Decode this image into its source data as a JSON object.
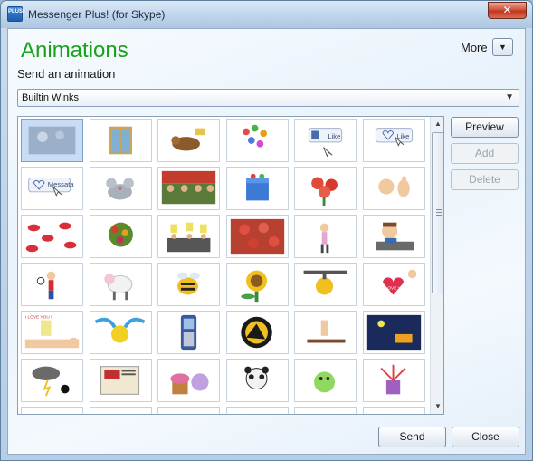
{
  "window": {
    "title": "Messenger Plus! (for Skype)",
    "icon_text": "PLUS!",
    "close_glyph": "✕"
  },
  "header": {
    "heading": "Animations",
    "more_label": "More",
    "more_arrow": "▼",
    "subtitle": "Send an animation"
  },
  "dropdown": {
    "selected": "Builtin Winks",
    "arrow": "▼"
  },
  "grid": {
    "selected_index": 0,
    "items": [
      {
        "name": "wink-fireworks-icon"
      },
      {
        "name": "wink-doors-icon"
      },
      {
        "name": "wink-sleeping-cat-icon"
      },
      {
        "name": "wink-balloons-icon"
      },
      {
        "name": "wink-like-button-icon",
        "text": "Like"
      },
      {
        "name": "wink-like-cursor-icon",
        "text": "Like"
      },
      {
        "name": "wink-messata-button-icon",
        "text": "Messata"
      },
      {
        "name": "wink-mouse-icon"
      },
      {
        "name": "wink-crowd-icon"
      },
      {
        "name": "wink-gift-box-icon"
      },
      {
        "name": "wink-roses-icon"
      },
      {
        "name": "wink-thumbs-up-icon"
      },
      {
        "name": "wink-kisses-icon"
      },
      {
        "name": "wink-flower-bouquet-icon"
      },
      {
        "name": "wink-score-cards-icon"
      },
      {
        "name": "wink-rose-bed-icon"
      },
      {
        "name": "wink-dancer-icon"
      },
      {
        "name": "wink-man-at-desk-icon"
      },
      {
        "name": "wink-tennis-player-icon"
      },
      {
        "name": "wink-sheep-icon"
      },
      {
        "name": "wink-bee-icon"
      },
      {
        "name": "wink-sunflower-icon"
      },
      {
        "name": "wink-bomb-icon"
      },
      {
        "name": "wink-love-heart-icon",
        "text": "I LOVE YOU"
      },
      {
        "name": "wink-hand-note-icon",
        "text": "I LOVE YOU !"
      },
      {
        "name": "wink-crying-face-icon"
      },
      {
        "name": "wink-mobile-phone-icon"
      },
      {
        "name": "wink-witch-moon-icon"
      },
      {
        "name": "wink-hand-wave-icon"
      },
      {
        "name": "wink-night-scene-icon"
      },
      {
        "name": "wink-storm-cloud-icon"
      },
      {
        "name": "wink-newspaper-icon"
      },
      {
        "name": "wink-cupcake-icon"
      },
      {
        "name": "wink-panda-icon"
      },
      {
        "name": "wink-green-blob-icon"
      },
      {
        "name": "wink-gift-explosion-icon"
      },
      {
        "name": "wink-partial-1-icon"
      },
      {
        "name": "wink-partial-2-icon"
      },
      {
        "name": "wink-partial-3-icon"
      },
      {
        "name": "wink-partial-4-icon"
      },
      {
        "name": "wink-partial-5-icon"
      },
      {
        "name": "wink-partial-6-icon"
      }
    ]
  },
  "scrollbar": {
    "up": "▲",
    "down": "▼"
  },
  "side_buttons": {
    "preview": "Preview",
    "add": "Add",
    "delete": "Delete"
  },
  "footer": {
    "send": "Send",
    "close": "Close"
  },
  "colors": {
    "heading": "#18a21a",
    "selection": "#c8dcf5"
  }
}
